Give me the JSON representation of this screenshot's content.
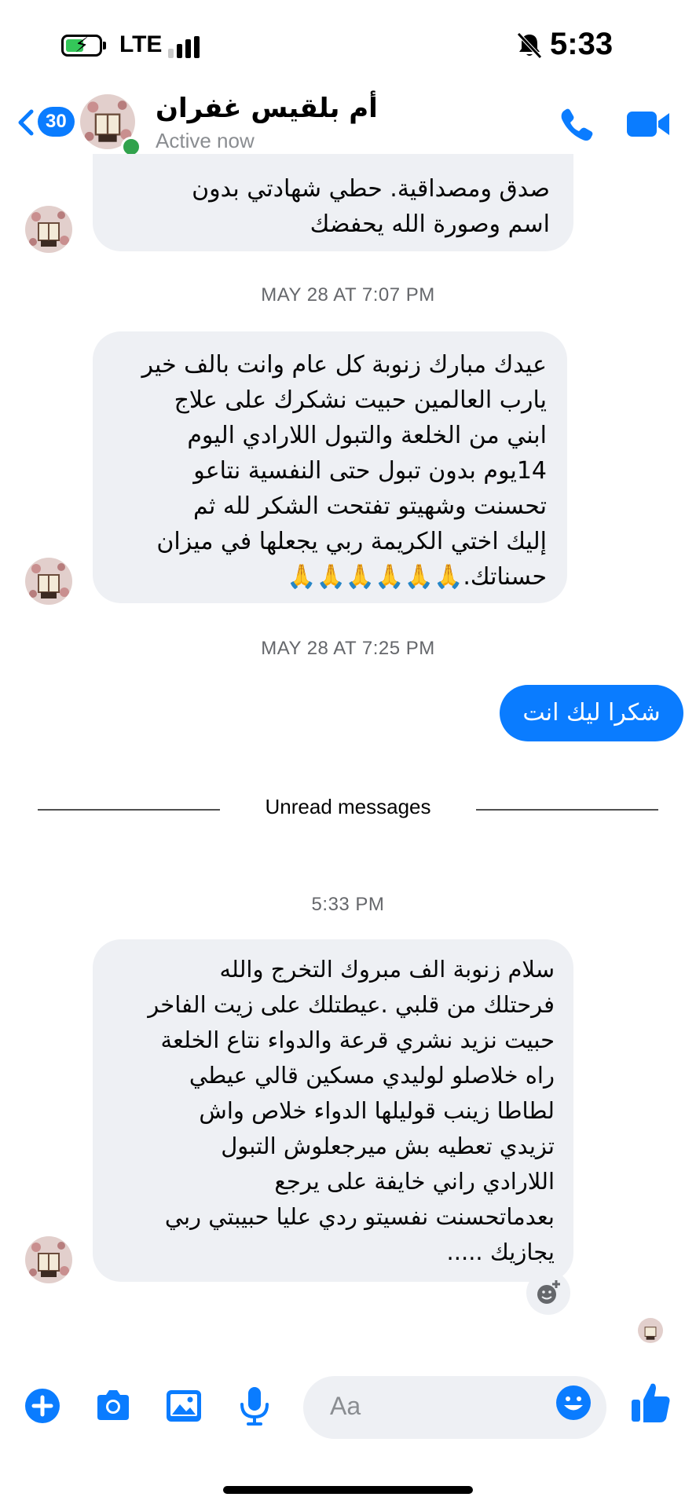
{
  "status_bar": {
    "carrier": "LTE",
    "time": "5:33"
  },
  "header": {
    "unread_count": "30",
    "contact_name": "أم بلقيس غفران",
    "presence": "Active now",
    "accent_color": "#0a7cff"
  },
  "messages": [
    {
      "type": "incoming",
      "text": "صدق ومصداقية.   حطي شهادتي بدون\nاسم وصورة  الله يحفضك"
    },
    {
      "type": "timestamp",
      "text": "MAY 28 AT 7:07 PM"
    },
    {
      "type": "incoming",
      "text": "عيدك مبارك زنوبة  كل عام وانت بالف خير\nيارب العالمين  حبيت نشكرك  على علاج\nابني من الخلعة والتبول اللارادي  اليوم\n14يوم بدون تبول  حتى النفسية نتاعو\nتحسنت  وشهيتو تفتحت الشكر لله  ثم\nإليك اختي الكريمة ربي يجعلها في ميزان\nحسناتك.🙏🙏🙏🙏🙏🙏"
    },
    {
      "type": "timestamp",
      "text": "MAY 28 AT 7:25 PM"
    },
    {
      "type": "outgoing",
      "text": "شكرا ليك انت"
    },
    {
      "type": "divider",
      "text": "Unread messages"
    },
    {
      "type": "timestamp",
      "text": "5:33 PM"
    },
    {
      "type": "incoming",
      "text": "سلام زنوبة الف مبروك التخرج والله\nفرحتلك من قلبي .عيطتلك على زيت الفاخر\nحبيت نزيد نشري قرعة والدواء نتاع الخلعة\nراه خلاصلو لوليدي  مسكين قالي عيطي\nلطاطا زينب قوليلها الدواء خلاص واش\nتزيدي تعطيه بش ميرجعلوش التبول\nاللارادي راني خايفة على يرجع\nبعدماتحسنت نفسيتو ردي عليا حبيبتي ربي\nيجازيك ....."
    }
  ],
  "composer": {
    "placeholder": "Aa"
  }
}
